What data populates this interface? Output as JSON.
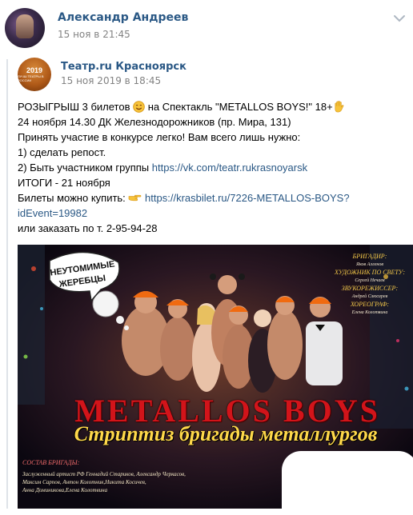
{
  "post": {
    "author": "Александр Андреев",
    "time": "15 ноя в 21:45"
  },
  "repost": {
    "group": "Театр.ru Красноярск",
    "time": "15 ноя 2019 в 18:45",
    "avatar_text": {
      "year": "2019",
      "caption": "ЛУЧШ ТЕАТРЫ В РОССИИ"
    }
  },
  "text": {
    "l1_a": "РОЗЫГРЫШ 3 билетов ",
    "l1_b": " на Спектакль \"METALLOS BOYS!\" 18+",
    "l2": "24 ноября 14.30 ДК Железнодорожников (пр. Мира, 131)",
    "l3": "Принять участие в конкурсе легко! Вам всего лишь нужно:",
    "l4": "1) сделать репост.",
    "l5_a": "2) Быть участником группы ",
    "l5_link": "https://vk.com/teatr.rukrasnoyarsk",
    "l6": "ИТОГИ - 21 ноября",
    "l7_a": "Билеты можно купить: ",
    "l7_link": "https://krasbilet.ru/7226-METALLOS-BOYS?",
    "l8_link": "idEvent=19982",
    "l9": "или заказать по т. 2-95-94-28"
  },
  "poster": {
    "badge_line1": "НЕУТОМИМЫЕ",
    "badge_line2": "ЖЕРЕБЦЫ",
    "title": "METALLOS BOYS",
    "subtitle": "Стриптиз бригады металлургов",
    "cast_heading": "СОСТАВ БРИГАДЫ:",
    "cast_line1": "Заслуженный артист РФ Геннадий Стариков, Александр Черкасов,",
    "cast_line2": "Максим Сарпов, Антон Колотник,Никита Косичев,",
    "cast_line3": "Анна Доминикова,Елена Колотвина",
    "credits": [
      {
        "h": "БРИГАДИР:",
        "n": "Яков Алленов"
      },
      {
        "h": "ХУДОЖНИК ПО СВЕТУ:",
        "n": "Сергей Нечаев"
      },
      {
        "h": "ЗВУКОРЕЖИССЕР:",
        "n": "Андрей Слюсарев"
      },
      {
        "h": "ХОРЕОГРАФ:",
        "n": "Елена Колотвина"
      }
    ]
  },
  "colors": {
    "link": "#2a5885",
    "meta": "#828282"
  }
}
